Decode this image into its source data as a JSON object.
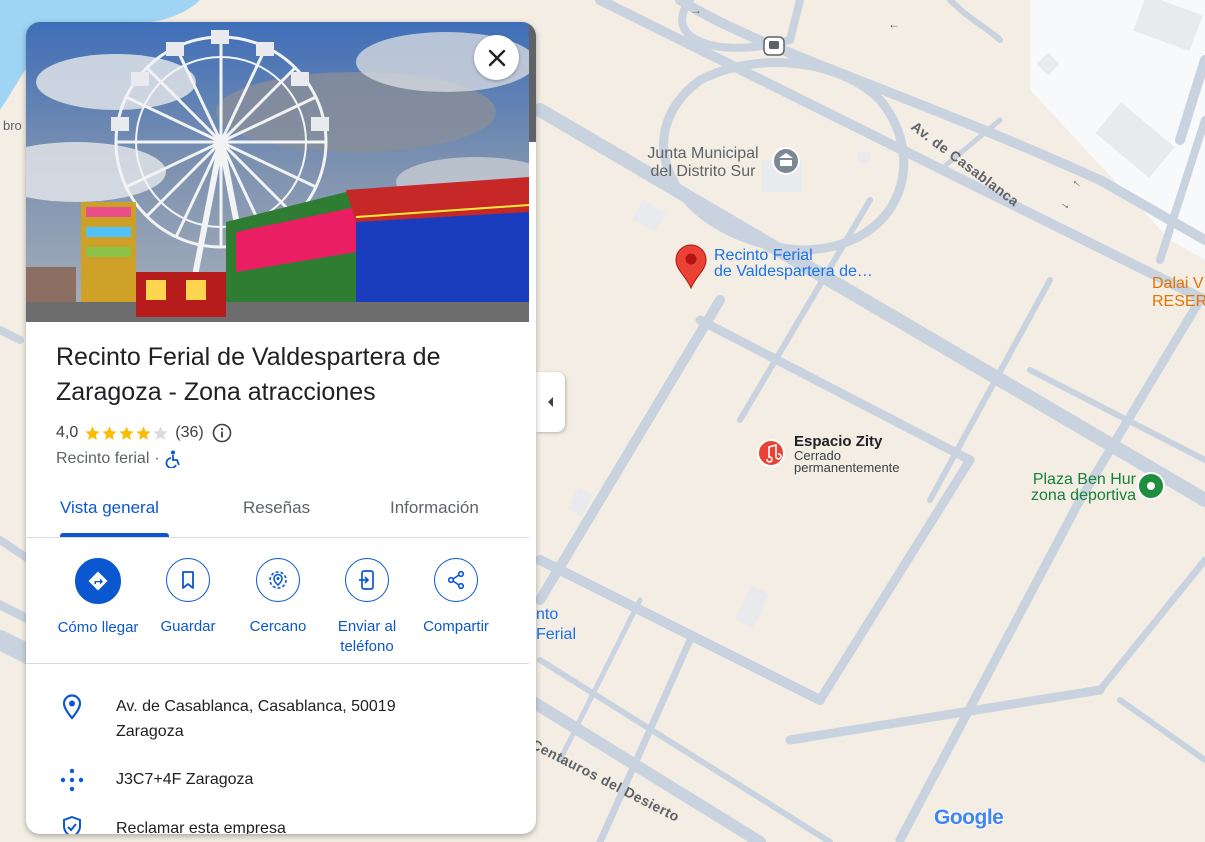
{
  "map": {
    "labels": {
      "junta_municipal": "Junta Municipal",
      "distrito_sur": "del Distrito Sur",
      "recinto_line1": "Recinto Ferial",
      "recinto_line2": "de Valdespartera de…",
      "espacio_zity": "Espacio Zity",
      "espacio_line1": "Cerrado",
      "espacio_line2": "permanentemente",
      "plaza_line1": "Plaza Ben Hur",
      "plaza_line2": "zona deportiva",
      "dalai_line1": "Dalai V",
      "dalai_line2": "RESER",
      "av_casablanca": "Av. de Casablanca",
      "centauros": "Centauros del Desierto",
      "partial_nto": "nto",
      "partial_ferial": "Ferial",
      "partial_ebro": "bro",
      "google_logo": "Google"
    },
    "colors": {
      "background": "#f3ede3",
      "road": "#c9d3e0",
      "water": "#9fd4f4",
      "pin_red": "#ea4335",
      "label_blue": "#1a73e8",
      "green": "#188038",
      "orange": "#e37400"
    }
  },
  "panel": {
    "close_icon": "close-icon",
    "title": "Recinto Ferial de Valdespartera de Zaragoza - Zona atracciones",
    "rating": {
      "value": "4,0",
      "stars_filled": 4,
      "stars_total": 5,
      "count": "(36)"
    },
    "category": "Recinto ferial",
    "category_separator": "·",
    "accessibility_icon": "wheelchair-icon",
    "tabs": [
      {
        "label": "Vista general",
        "active": true
      },
      {
        "label": "Reseñas",
        "active": false
      },
      {
        "label": "Información",
        "active": false
      }
    ],
    "actions": [
      {
        "label": "Cómo llegar",
        "icon": "directions-icon"
      },
      {
        "label": "Guardar",
        "icon": "bookmark-icon"
      },
      {
        "label": "Cercano",
        "icon": "nearby-icon"
      },
      {
        "label": "Enviar al teléfono",
        "icon": "send-to-phone-icon"
      },
      {
        "label": "Compartir",
        "icon": "share-icon"
      }
    ],
    "info": {
      "address": "Av. de Casablanca, Casablanca, 50019 Zaragoza",
      "plus_code": "J3C7+4F Zaragoza",
      "claim": "Reclamar esta empresa"
    },
    "accent": "#0b57d0"
  }
}
